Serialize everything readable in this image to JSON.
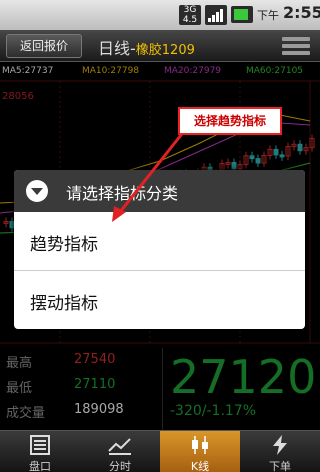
{
  "status_bar": {
    "network_label_top": "3G",
    "network_label_bottom": "4.5",
    "period": "下午",
    "time": "2:55",
    "icons": [
      "network-3g-icon",
      "signal-icon",
      "battery-icon"
    ]
  },
  "title_bar": {
    "back_label": "返回报价",
    "title": "日线-",
    "instrument": "橡胶1209",
    "menu_icon": "menu-icon"
  },
  "chart": {
    "ma_labels": [
      {
        "text": "MA5:27737",
        "color": "#ffffff"
      },
      {
        "text": "MA10:27798",
        "color": "#f0c000"
      },
      {
        "text": "MA20:27979",
        "color": "#d040d0"
      },
      {
        "text": "MA60:27105",
        "color": "#33cc33"
      }
    ],
    "price_tick": "28056"
  },
  "info": {
    "rows": [
      {
        "label": "最高",
        "value": "27540",
        "color": "#e03030"
      },
      {
        "label": "最低",
        "value": "27110",
        "color": "#1faa3a"
      },
      {
        "label": "成交量",
        "value": "189098",
        "color": "#ffffff"
      }
    ],
    "price": "27120",
    "change": "-320/-1.17%"
  },
  "callout": {
    "text": "选择趋势指标"
  },
  "dialog": {
    "title": "请选择指标分类",
    "items": [
      "趋势指标",
      "摆动指标"
    ]
  },
  "bottom_nav": {
    "items": [
      {
        "label": "盘口",
        "icon": "list-icon",
        "active": false
      },
      {
        "label": "分时",
        "icon": "trend-icon",
        "active": false
      },
      {
        "label": "K线",
        "icon": "candlestick-icon",
        "active": true
      },
      {
        "label": "下单",
        "icon": "lightning-icon",
        "active": false
      }
    ]
  },
  "colors": {
    "accent": "#d9962a",
    "up": "#e03030",
    "down": "#1faa3a",
    "callout_border": "#e22222"
  }
}
